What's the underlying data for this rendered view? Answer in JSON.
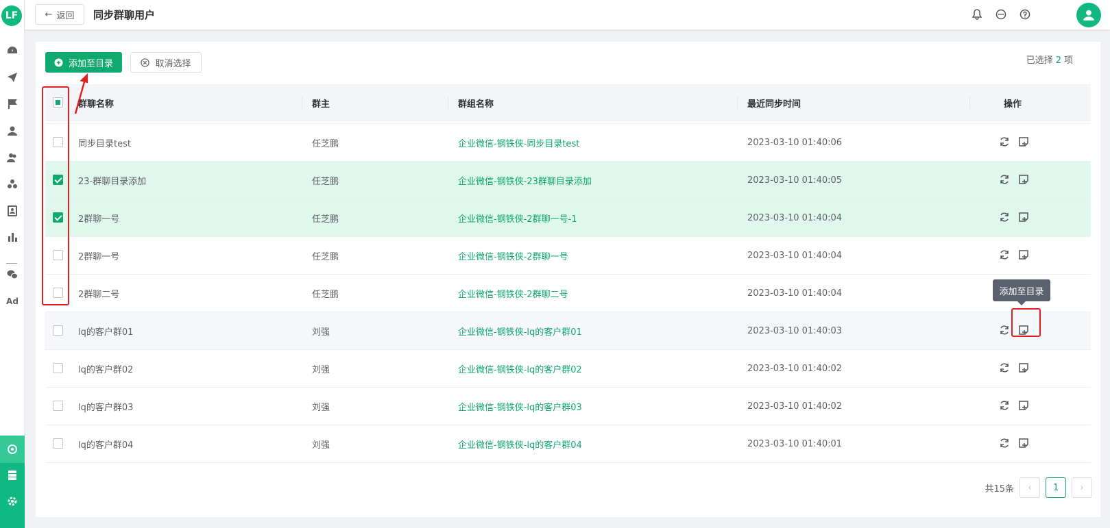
{
  "app": {
    "logo_text": "LF"
  },
  "sidebar": {
    "items": [
      "dashboard-icon",
      "send-icon",
      "flag-icon",
      "user-icon",
      "users-icon",
      "group-icon",
      "contact-book-icon",
      "bar-chart-icon",
      "wechat-icon",
      "ad-icon"
    ],
    "ad_label": "Ad",
    "bottom_items": [
      "customer-group-icon",
      "storage-icon",
      "settings-icon"
    ]
  },
  "header": {
    "back_label": "返回",
    "title": "同步群聊用户",
    "icons": [
      "bell-icon",
      "message-icon",
      "help-icon",
      "avatar"
    ]
  },
  "toolbar": {
    "add_label": "添加至目录",
    "cancel_label": "取消选择",
    "selected_prefix": "已选择",
    "selected_count": "2",
    "selected_suffix": "项"
  },
  "table": {
    "columns": [
      "群聊名称",
      "群主",
      "群组名称",
      "最近同步时间",
      "操作"
    ],
    "rows": [
      {
        "name": "同步目录test",
        "owner": "任芝鹏",
        "group": "企业微信-钢铁侠-同步目录test",
        "time": "2023-03-10 01:40:06",
        "checked": false
      },
      {
        "name": "23-群聊目录添加",
        "owner": "任芝鹏",
        "group": "企业微信-钢铁侠-23群聊目录添加",
        "time": "2023-03-10 01:40:05",
        "checked": true
      },
      {
        "name": "2群聊一号",
        "owner": "任芝鹏",
        "group": "企业微信-钢铁侠-2群聊一号-1",
        "time": "2023-03-10 01:40:04",
        "checked": true
      },
      {
        "name": "2群聊一号",
        "owner": "任芝鹏",
        "group": "企业微信-钢铁侠-2群聊一号",
        "time": "2023-03-10 01:40:04",
        "checked": false
      },
      {
        "name": "2群聊二号",
        "owner": "任芝鹏",
        "group": "企业微信-钢铁侠-2群聊二号",
        "time": "2023-03-10 01:40:04",
        "checked": false
      },
      {
        "name": "lq的客户群01",
        "owner": "刘强",
        "group": "企业微信-钢铁侠-lq的客户群01",
        "time": "2023-03-10 01:40:03",
        "checked": false
      },
      {
        "name": "lq的客户群02",
        "owner": "刘强",
        "group": "企业微信-钢铁侠-lq的客户群02",
        "time": "2023-03-10 01:40:02",
        "checked": false
      },
      {
        "name": "lq的客户群03",
        "owner": "刘强",
        "group": "企业微信-钢铁侠-lq的客户群03",
        "time": "2023-03-10 01:40:02",
        "checked": false
      },
      {
        "name": "lq的客户群04",
        "owner": "刘强",
        "group": "企业微信-钢铁侠-lq的客户群04",
        "time": "2023-03-10 01:40:01",
        "checked": false
      }
    ]
  },
  "tooltip": {
    "text": "添加至目录"
  },
  "pagination": {
    "total_label": "共15条",
    "current_page": "1"
  },
  "colors": {
    "accent": "#10a96f",
    "annotation": "#e02020"
  }
}
